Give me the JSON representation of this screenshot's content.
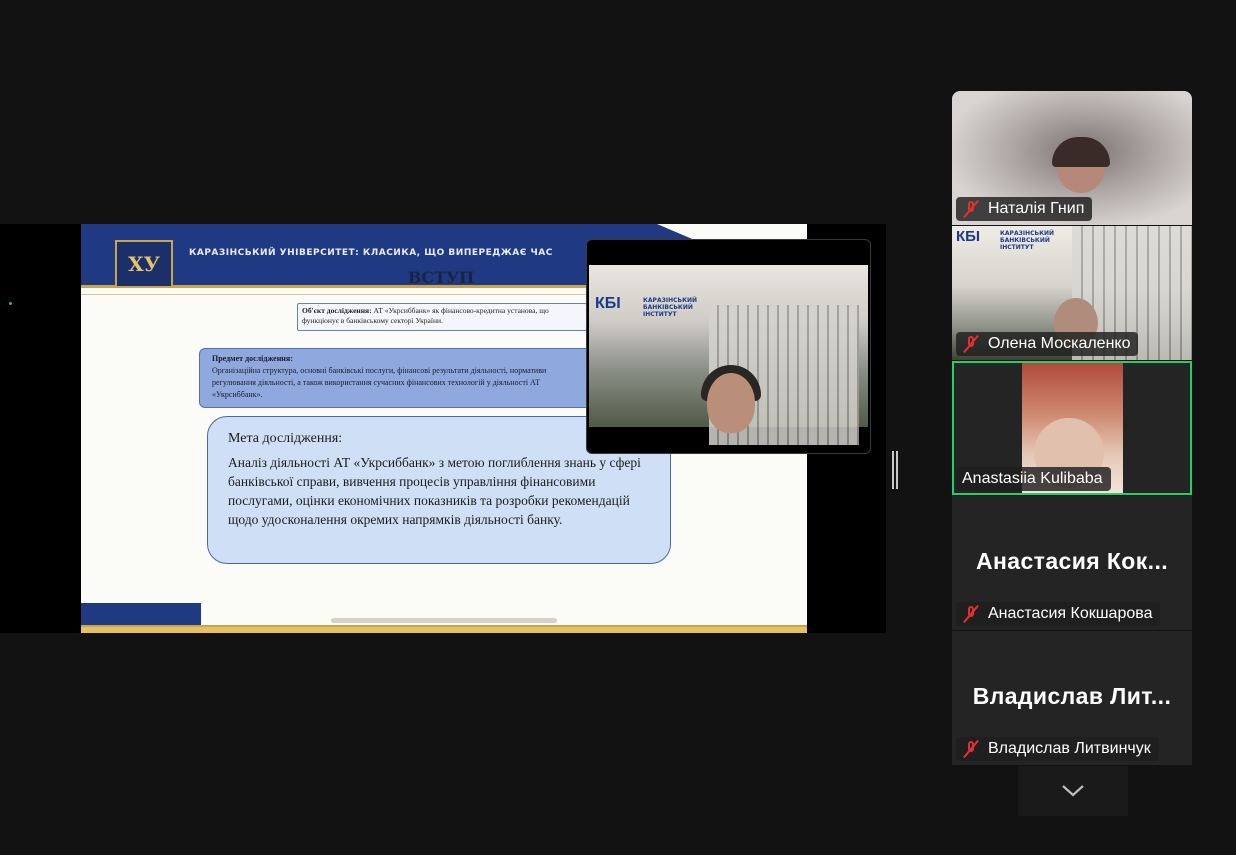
{
  "shared_screen": {
    "slide": {
      "logo_text": "ХУ",
      "university_banner": "КАРАЗІНСЬКИЙ УНІВЕРСИТЕТ: КЛАСИКА, ЩО ВИПЕРЕДЖАЄ ЧАС",
      "heading": "ВСТУП",
      "object_label": "Об'єкт дослідження:",
      "object_text": "АТ «Укрсиббанк» як фінансово-кредитна установа, що функціонує в банківському секторі України.",
      "subject_label": "Предмет дослідження:",
      "subject_text": "Організаційна структура, основні банківські послуги, фінансові результати діяльності, нормативи регулювання діяльності, а також використання сучасних фінансових технологій у діяльності АТ «Укрсиббанк».",
      "goal_label": "Мета дослідження:",
      "goal_text": "Аналіз діяльності АТ «Укрсиббанк» з метою поглиблення знань у сфері банківської справи, вивчення процесів управління фінансовими послугами, оцінки економічних показників та розробки рекомендацій щодо удосконалення окремих напрямків діяльності банку."
    },
    "floating_video": {
      "logo": "КБІ",
      "logo_sub": "КАРАЗІНСЬКИЙ БАНКІВСЬКИЙ ІНСТИТУТ"
    }
  },
  "participants": [
    {
      "name": "Наталія Гнип",
      "muted": true,
      "video": true
    },
    {
      "name": "Олена Москаленко",
      "muted": true,
      "video": true,
      "logo": "КБІ",
      "logo_sub": "КАРАЗІНСЬКИЙ БАНКІВСЬКИЙ ІНСТИТУТ"
    },
    {
      "name": "Anastasiia Kulibaba",
      "muted": false,
      "video": true,
      "active_speaker": true
    },
    {
      "name": "Анастасия Кокшарова",
      "display_name": "Анастасия  Кок...",
      "muted": true,
      "video": false
    },
    {
      "name": "Владислав Литвинчук",
      "display_name": "Владислав  Лит...",
      "muted": true,
      "video": false
    }
  ],
  "colors": {
    "background": "#121212",
    "active_speaker_border": "#22d06a",
    "muted_icon": "#e0302f",
    "slide_blue": "#1f3a82",
    "slide_gold": "#c9a44a"
  },
  "icons": {
    "mic_muted": "mic-muted-icon",
    "scroll_down": "chevron-down-icon",
    "splitter": "resize-handle-icon"
  }
}
